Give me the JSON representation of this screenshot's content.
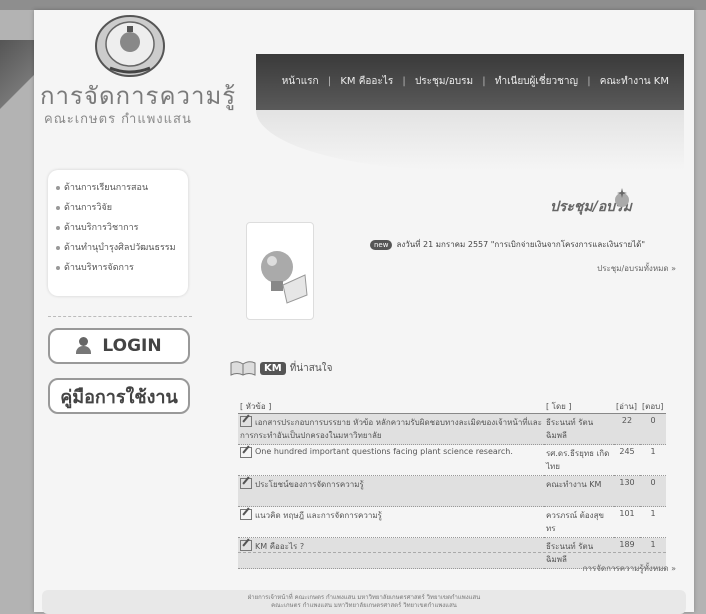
{
  "header": {
    "site_title": "การจัดการความรู้",
    "site_subtitle": "คณะเกษตร กำแพงแสน",
    "nav": [
      "หน้าแรก",
      "KM คืออะไร",
      "ประชุม/อบรม",
      "ทำเนียบผู้เชี่ยวชาญ",
      "คณะทำงาน KM"
    ],
    "nav_separator": "|"
  },
  "sidebar": {
    "items": [
      {
        "label": "ด้านการเรียนการสอน"
      },
      {
        "label": "ด้านการวิจัย"
      },
      {
        "label": "ด้านบริการวิชาการ"
      },
      {
        "label": "ด้านทำนุบำรุงศิลปวัฒนธรรม"
      },
      {
        "label": "ด้านบริหารจัดการ"
      }
    ],
    "login_label": "LOGIN",
    "manual_label": "คู่มือการใช้งาน"
  },
  "training": {
    "title": "ประชุม/อบรม",
    "news_badge": "new",
    "news_text": "ลงวันที่ 21 มกราคม 2557 \"การเบิกจ่ายเงินจากโครงการและเงินรายได้\"",
    "all_link": "ประชุม/อบรมทั้งหมด »"
  },
  "km": {
    "badge": "KM",
    "title": "ที่น่าสนใจ",
    "columns": [
      "[ หัวข้อ ]",
      "[ โดย ]",
      "[อ่าน]",
      "[ตอบ]"
    ],
    "rows": [
      {
        "title": "เอกสารประกอบการบรรยาย หัวข้อ หลักความรับผิดชอบทางละเมิดของเจ้าหน้าที่และการกระทำอันเป็นปกครองในมหาวิทยาลัย",
        "by": "ธีระนนท์ รัตนฉิมพลี",
        "reads": "22",
        "replies": "0"
      },
      {
        "title": "One hundred important questions facing plant science research.",
        "by": "รศ.ดร.ธีรยุทธ เกิดไทย",
        "reads": "245",
        "replies": "1"
      },
      {
        "title": "ประโยชน์ของการจัดการความรู้",
        "by": "คณะทำงาน KM",
        "reads": "130",
        "replies": "0"
      },
      {
        "title": "แนวคิด ทฤษฎี และการจัดการความรู้",
        "by": "ควรภรณ์ ต้องสุขทร",
        "reads": "101",
        "replies": "1"
      },
      {
        "title": "KM คืออะไร ?",
        "by": "ธีระนนท์ รัตนฉิมพลี",
        "reads": "189",
        "replies": "1"
      }
    ],
    "all_link": "การจัดการความรู้ทั้งหมด »"
  },
  "footer": {
    "line1": "ฝ่ายการเจ้าหน้าที่ คณะเกษตร กำแพงแสน มหาวิทยาลัยเกษตรศาสตร์ วิทยาเขตกำแพงแสน",
    "line2": "คณะเกษตร กำแพงแสน มหาวิทยาลัยเกษตรศาสตร์ วิทยาเขตกำแพงแสน"
  }
}
